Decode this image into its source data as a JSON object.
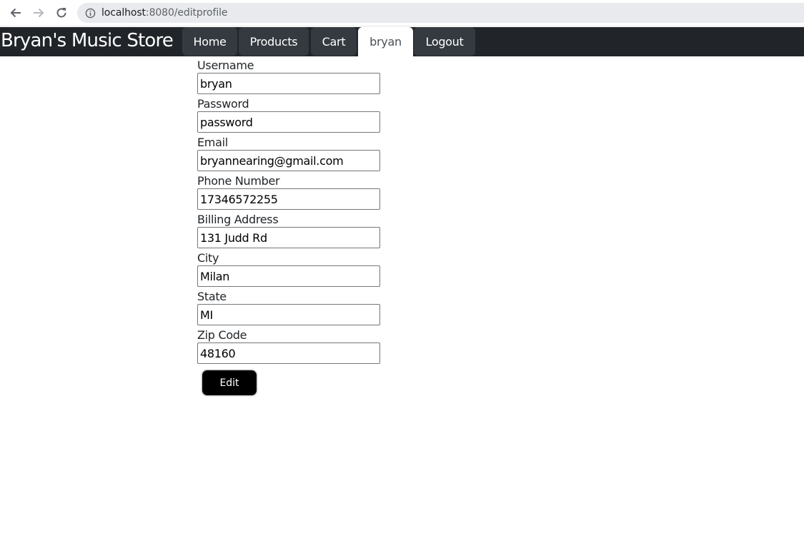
{
  "browser": {
    "url_host": "localhost",
    "url_path": ":8080/editprofile"
  },
  "site": {
    "brand": "Bryan's Music Store",
    "nav": {
      "home": "Home",
      "products": "Products",
      "cart": "Cart",
      "user": "bryan",
      "logout": "Logout"
    },
    "active_tab": "bryan"
  },
  "form": {
    "fields": [
      {
        "label": "Username",
        "value": "bryan"
      },
      {
        "label": "Password",
        "value": "password"
      },
      {
        "label": "Email",
        "value": "bryannearing@gmail.com"
      },
      {
        "label": "Phone Number",
        "value": "17346572255"
      },
      {
        "label": "Billing Address",
        "value": "131 Judd Rd"
      },
      {
        "label": "City",
        "value": "Milan"
      },
      {
        "label": "State",
        "value": "MI"
      },
      {
        "label": "Zip Code",
        "value": "48160"
      }
    ],
    "submit_label": "Edit"
  },
  "colors": {
    "header_bg": "#212529",
    "tab_bg": "#343a40",
    "button_bg": "#000000"
  }
}
